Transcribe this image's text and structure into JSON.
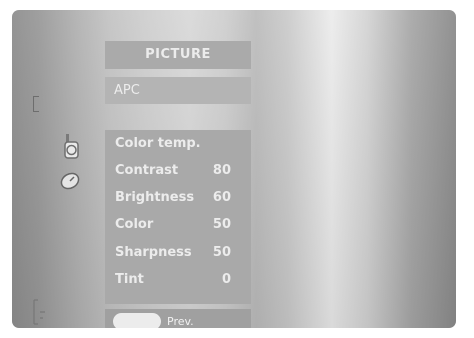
{
  "menu": {
    "title": "PICTURE",
    "apc_label": "APC",
    "items": [
      {
        "label": "Color temp.",
        "value": ""
      },
      {
        "label": "Contrast",
        "value": "80"
      },
      {
        "label": "Brightness",
        "value": "60"
      },
      {
        "label": "Color",
        "value": "50"
      },
      {
        "label": "Sharpness",
        "value": "50"
      },
      {
        "label": "Tint",
        "value": "0"
      }
    ],
    "footer": {
      "prev_label": "Prev."
    }
  },
  "side_icons": [
    "bracket-icon",
    "speaker-icon",
    "clock-icon",
    "input-icon"
  ]
}
